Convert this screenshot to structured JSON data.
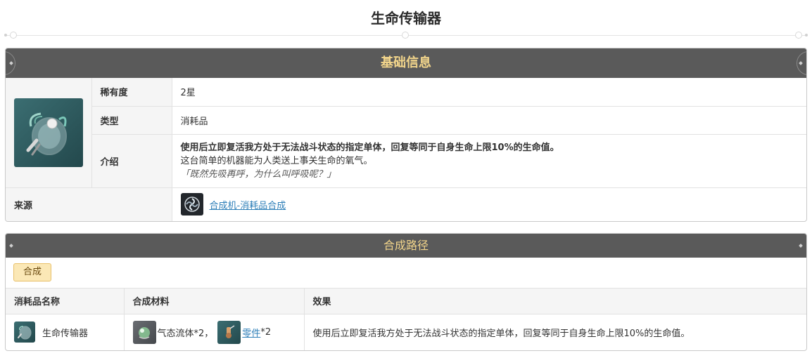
{
  "page": {
    "title": "生命传输器"
  },
  "basic_info": {
    "header": "基础信息",
    "rarity_label": "稀有度",
    "rarity_value": "2星",
    "type_label": "类型",
    "type_value": "消耗品",
    "intro_label": "介绍",
    "intro_bold": "使用后立即复活我方处于无法战斗状态的指定单体，回复等同于自身生命上限10%的生命值。",
    "intro_text": "这台简单的机器能为人类送上事关生命的氧气。",
    "intro_quote": "「既然先吸再呼，为什么叫呼吸呢？」",
    "source_label": "来源",
    "source_link": "合成机-消耗品合成",
    "item_icon": "oxygen-mask-icon",
    "source_icon": "synthesizer-icon"
  },
  "recipe": {
    "header": "合成路径",
    "tab_label": "合成",
    "columns": [
      "消耗品名称",
      "合成材料",
      "效果"
    ],
    "row": {
      "name": "生命传输器",
      "material1_name": "气态流体*2",
      "material1_sep": "，",
      "material2_name": "零件",
      "material2_count": "*2",
      "effect": "使用后立即复活我方处于无法战斗状态的指定单体，回复等同于自身生命上限10%的生命值。"
    }
  },
  "colors": {
    "header_bg": "#5a5a5a",
    "header_text": "#f2d58b",
    "link": "#2e7fb8",
    "tab_bg": "#fbe8b6"
  }
}
